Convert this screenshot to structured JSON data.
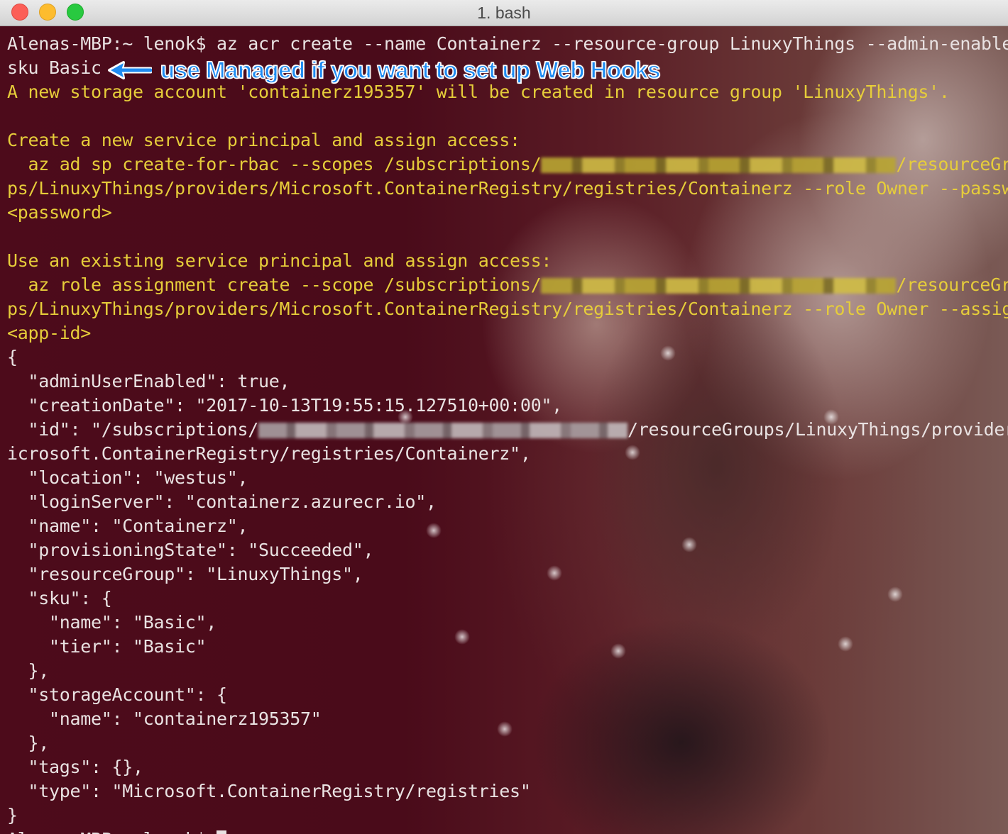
{
  "window": {
    "title": "1. bash",
    "controls": [
      "close",
      "minimize",
      "zoom"
    ]
  },
  "annotation": {
    "text": "use Managed if you want to set up Web Hooks",
    "icon": "arrow-left-icon",
    "color": "#1f8cf2"
  },
  "terminal": {
    "text_color": "#e9e2e2",
    "warning_color": "#e6cd3a",
    "lines": [
      {
        "pre": "Alenas-MBP:~ lenok$ az acr create --name Containerz --resource-group LinuxyThings --admin-enabled --",
        "kind": "plain"
      },
      {
        "pre": "sku Basic",
        "kind": "plain"
      },
      {
        "pre": "A new storage account 'containerz195357' will be created in resource group 'LinuxyThings'.",
        "kind": "warn"
      },
      {
        "pre": "",
        "kind": "plain"
      },
      {
        "pre": "Create a new service principal and assign access:",
        "kind": "warn"
      },
      {
        "pre": "  az ad sp create-for-rbac --scopes /subscriptions/",
        "redacted": true,
        "post": "/resourceGrou",
        "kind": "warn"
      },
      {
        "pre": "ps/LinuxyThings/providers/Microsoft.ContainerRegistry/registries/Containerz --role Owner --password",
        "kind": "warn"
      },
      {
        "pre": "<password>",
        "kind": "warn"
      },
      {
        "pre": "",
        "kind": "plain"
      },
      {
        "pre": "Use an existing service principal and assign access:",
        "kind": "warn"
      },
      {
        "pre": "  az role assignment create --scope /subscriptions/",
        "redacted": true,
        "post": "/resourceGrou",
        "kind": "warn"
      },
      {
        "pre": "ps/LinuxyThings/providers/Microsoft.ContainerRegistry/registries/Containerz --role Owner --assignee",
        "kind": "warn"
      },
      {
        "pre": "<app-id>",
        "kind": "warn"
      },
      {
        "pre": "{",
        "kind": "plain"
      },
      {
        "pre": "  \"adminUserEnabled\": true,",
        "kind": "plain"
      },
      {
        "pre": "  \"creationDate\": \"2017-10-13T19:55:15.127510+00:00\",",
        "kind": "plain"
      },
      {
        "pre": "  \"id\": \"/subscriptions/",
        "redacted": true,
        "post": "/resourceGroups/LinuxyThings/providers/M",
        "kind": "plain"
      },
      {
        "pre": "icrosoft.ContainerRegistry/registries/Containerz\",",
        "kind": "plain"
      },
      {
        "pre": "  \"location\": \"westus\",",
        "kind": "plain"
      },
      {
        "pre": "  \"loginServer\": \"containerz.azurecr.io\",",
        "kind": "plain"
      },
      {
        "pre": "  \"name\": \"Containerz\",",
        "kind": "plain"
      },
      {
        "pre": "  \"provisioningState\": \"Succeeded\",",
        "kind": "plain"
      },
      {
        "pre": "  \"resourceGroup\": \"LinuxyThings\",",
        "kind": "plain"
      },
      {
        "pre": "  \"sku\": {",
        "kind": "plain"
      },
      {
        "pre": "    \"name\": \"Basic\",",
        "kind": "plain"
      },
      {
        "pre": "    \"tier\": \"Basic\"",
        "kind": "plain"
      },
      {
        "pre": "  },",
        "kind": "plain"
      },
      {
        "pre": "  \"storageAccount\": {",
        "kind": "plain"
      },
      {
        "pre": "    \"name\": \"containerz195357\"",
        "kind": "plain"
      },
      {
        "pre": "  },",
        "kind": "plain"
      },
      {
        "pre": "  \"tags\": {},",
        "kind": "plain"
      },
      {
        "pre": "  \"type\": \"Microsoft.ContainerRegistry/registries\"",
        "kind": "plain"
      },
      {
        "pre": "}",
        "kind": "plain"
      },
      {
        "pre": "Alenas-MBP:~ lenok$ ",
        "kind": "plain",
        "cursor": true
      }
    ]
  }
}
